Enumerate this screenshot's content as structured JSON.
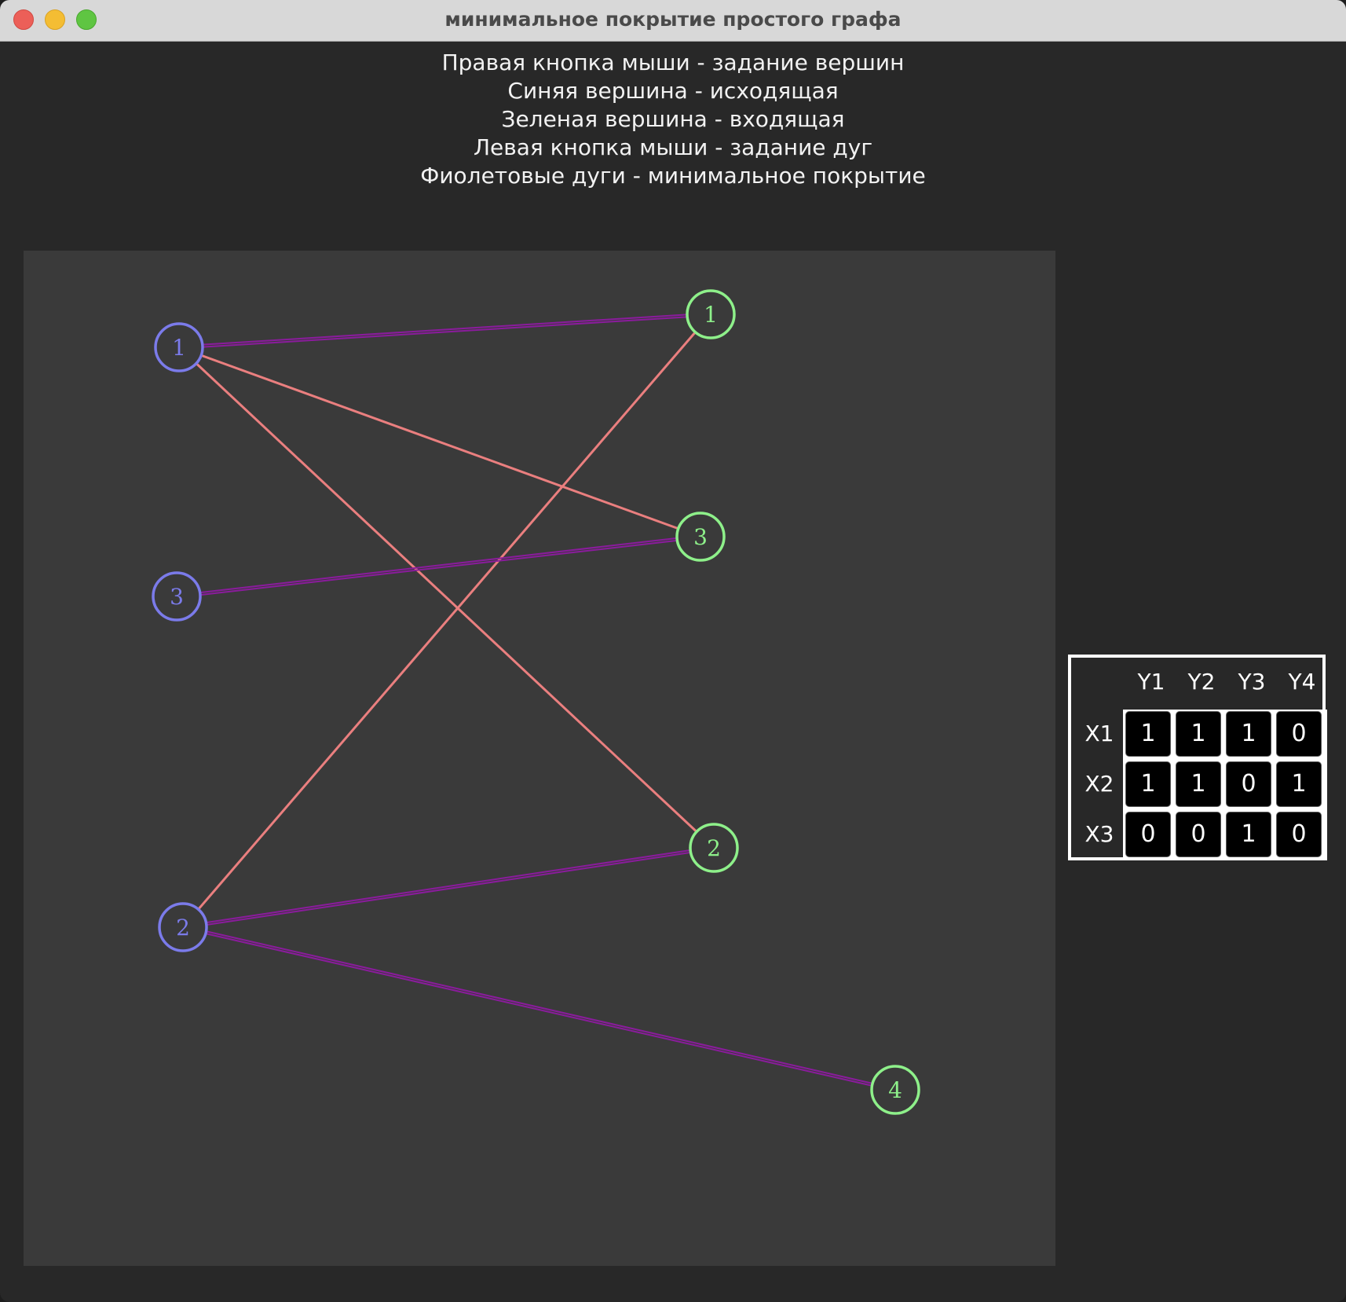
{
  "window": {
    "title": "минимальное покрытие простого графа"
  },
  "instructions": [
    "Правая кнопка мыши - задание вершин",
    "Синяя вершина - исходящая",
    "Зеленая вершина - входящая",
    "Левая кнопка мыши - задание дуг",
    "Фиолетовые дуги - минимальное покрытие"
  ],
  "colors": {
    "source_vertex": "#7b7bea",
    "target_vertex": "#8ef08a",
    "edge": "#ea7f7f",
    "cover_edge": "#8a1c9c",
    "canvas_bg": "#3a3a3a"
  },
  "graph": {
    "source_vertices": [
      {
        "id": "X1",
        "label": "1"
      },
      {
        "id": "X2",
        "label": "2"
      },
      {
        "id": "X3",
        "label": "3"
      }
    ],
    "target_vertices": [
      {
        "id": "Y1",
        "label": "1"
      },
      {
        "id": "Y2",
        "label": "2"
      },
      {
        "id": "Y3",
        "label": "3"
      },
      {
        "id": "Y4",
        "label": "4"
      }
    ],
    "edges": [
      {
        "from": "X1",
        "to": "Y1",
        "cover": true
      },
      {
        "from": "X1",
        "to": "Y2",
        "cover": false
      },
      {
        "from": "X1",
        "to": "Y3",
        "cover": false
      },
      {
        "from": "X2",
        "to": "Y1",
        "cover": false
      },
      {
        "from": "X2",
        "to": "Y2",
        "cover": true
      },
      {
        "from": "X2",
        "to": "Y4",
        "cover": true
      },
      {
        "from": "X3",
        "to": "Y3",
        "cover": true
      }
    ]
  },
  "matrix": {
    "columns": [
      "Y1",
      "Y2",
      "Y3",
      "Y4"
    ],
    "rows": [
      {
        "label": "X1",
        "values": [
          "1",
          "1",
          "1",
          "0"
        ]
      },
      {
        "label": "X2",
        "values": [
          "1",
          "1",
          "0",
          "1"
        ]
      },
      {
        "label": "X3",
        "values": [
          "0",
          "0",
          "1",
          "0"
        ]
      }
    ]
  }
}
